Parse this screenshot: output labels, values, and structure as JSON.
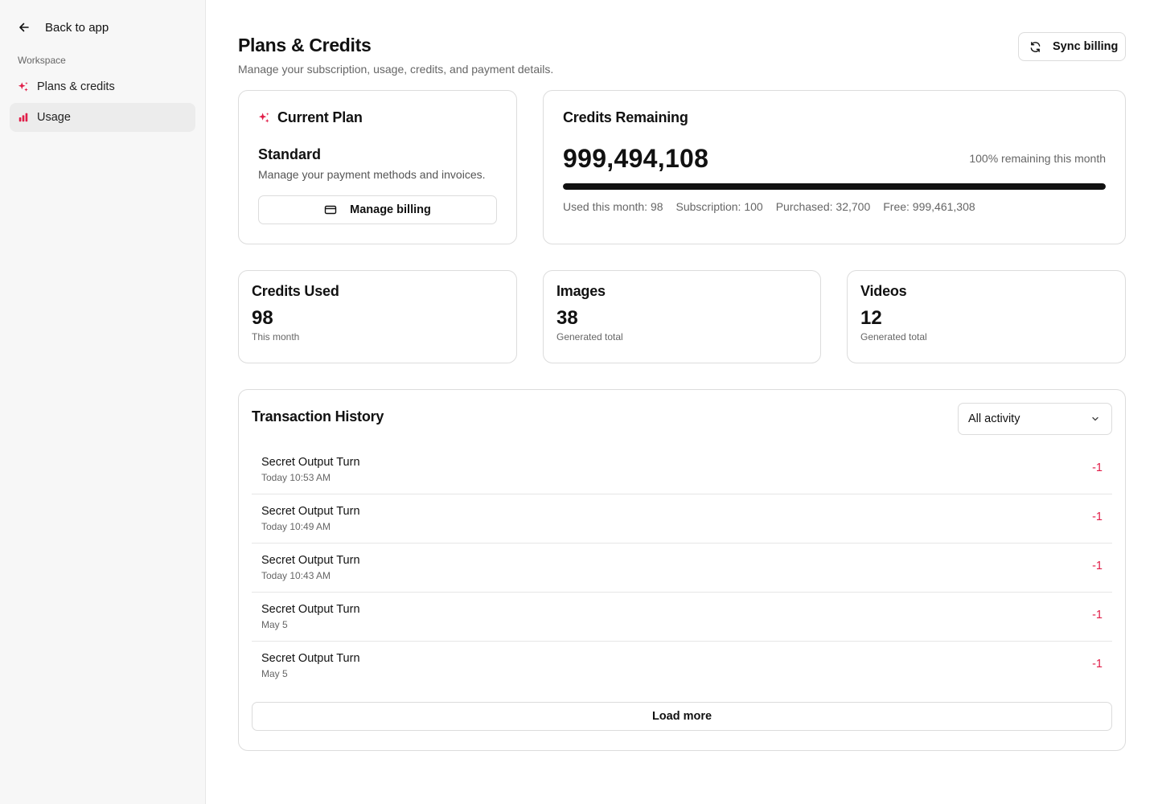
{
  "sidebar": {
    "back_label": "Back to app",
    "section_label": "Workspace",
    "items": [
      {
        "label": "Plans & credits",
        "icon": "sparkles-icon"
      },
      {
        "label": "Usage",
        "icon": "bar-chart-icon"
      }
    ],
    "active_item": "Usage"
  },
  "header": {
    "title": "Plans & Credits",
    "subtitle": "Manage your subscription, usage, credits, and payment details.",
    "sync_label": "Sync billing"
  },
  "plan": {
    "heading": "Current Plan",
    "name": "Standard",
    "description": "Manage your payment methods and invoices.",
    "manage_label": "Manage billing"
  },
  "credits": {
    "heading": "Credits Remaining",
    "amount": "999,494,108",
    "percent_text": "100% remaining this month",
    "remaining_fraction": 1.0,
    "stats": {
      "used": "Used this month: 98",
      "subscription": "Subscription: 100",
      "purchased": "Purchased: 32,700",
      "free": "Free: 999,461,308"
    }
  },
  "stats": {
    "used": {
      "title": "Credits Used",
      "value": "98",
      "sub": "This month"
    },
    "images": {
      "title": "Images",
      "value": "38",
      "sub": "Generated total"
    },
    "videos": {
      "title": "Videos",
      "value": "12",
      "sub": "Generated total"
    }
  },
  "history": {
    "title": "Transaction History",
    "filter_value": "All activity",
    "transactions": [
      {
        "name": "Secret Output Turn",
        "date": "Today 10:53 AM",
        "amount": "-1"
      },
      {
        "name": "Secret Output Turn",
        "date": "Today 10:49 AM",
        "amount": "-1"
      },
      {
        "name": "Secret Output Turn",
        "date": "Today 10:43 AM",
        "amount": "-1"
      },
      {
        "name": "Secret Output Turn",
        "date": "May 5",
        "amount": "-1"
      },
      {
        "name": "Secret Output Turn",
        "date": "May 5",
        "amount": "-1"
      }
    ],
    "load_more_label": "Load more"
  },
  "colors": {
    "accent": "#e11d48",
    "bar_fill": "#111111",
    "negative_amount": "#e11d48"
  }
}
